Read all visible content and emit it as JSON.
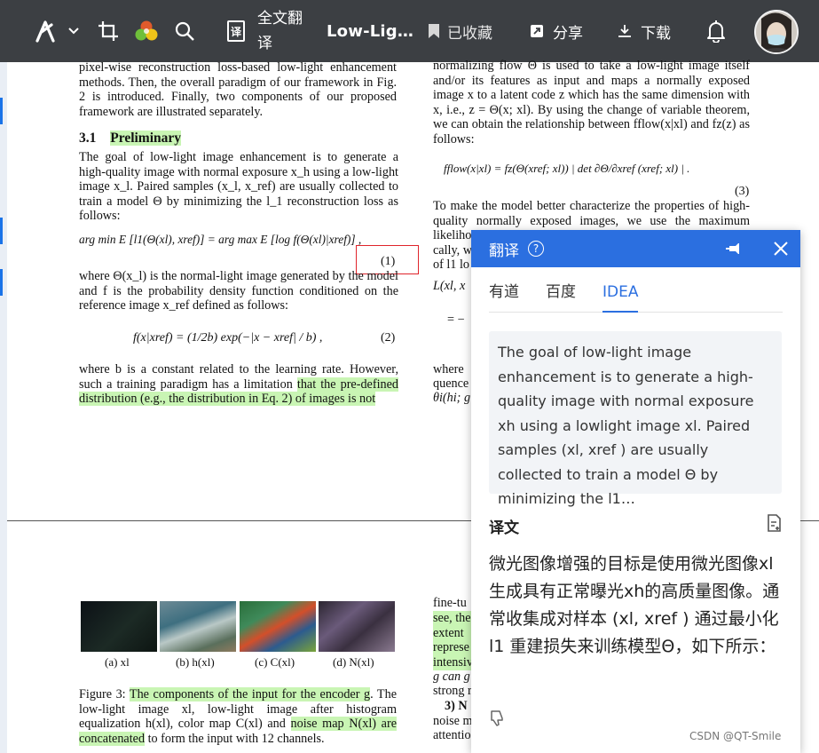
{
  "toolbar": {
    "full_translate": "全文翻译",
    "doc_title": "Low-Lig…",
    "favorited": "已收藏",
    "share": "分享",
    "download": "下载"
  },
  "paper": {
    "left_intro": "pixel-wise reconstruction loss-based low-light enhancement methods.  Then, the overall paradigm of our framework in Fig. 2 is introduced. Finally, two components of our proposed framework are illustrated separately.",
    "section_num": "3.1",
    "section_title": "Preliminary",
    "left_p1": "The goal of low-light image enhancement is to generate a high-quality image with normal exposure x_h using a low-light image x_l. Paired samples (x_l, x_ref) are usually collected to train a model Θ by minimizing the l_1 reconstruction loss as follows:",
    "eq1": "arg min E [l1(Θ(xl), xref)] = arg max E [log f(Θ(xl)|xref)] ,",
    "eq1_num": "(1)",
    "left_p2": "where Θ(x_l) is the normal-light image generated by the model and f is the probability density function conditioned on the reference image x_ref defined as follows:",
    "eq2": "f(x|xref) = (1/2b) exp(−|x − xref| / b) ,",
    "eq2_num": "(2)",
    "left_p3_a": "where b is a constant related to the learning rate. However, such a training paradigm has a limitation ",
    "left_p3_hl": "that the pre-defined distribution (e.g., the distribution in Eq. 2) of images is not",
    "right_p1": "normalizing flow Θ is used to take a low-light image itself and/or its features as input and maps a normally exposed image x to a latent code z which has the same dimension with x, i.e., z = Θ(x; xl). By using the change of variable theorem, we can obtain the relationship between fflow(x|xl) and fz(z) as follows:",
    "eq3": "fflow(x|xl) = fz(Θ(xref; xl)) | det ∂Θ/∂xref (xref; xl) | .",
    "eq3_num": "(3)",
    "right_p2": "To make the model better characterize the properties of high-quality normally exposed images, we use the maximum likelihood …",
    "right_frag1": "likeliho",
    "right_frag2": "cally, w",
    "right_frag3": "of l1 lo",
    "right_frag4": "L(xl, x",
    "right_frag5": "= −",
    "right_frag6": "where",
    "right_frag7": "quence",
    "right_frag8": "θi(hi; g",
    "fig_caps": [
      "(a) xl",
      "(b) h(xl)",
      "(c) C(xl)",
      "(d) N(xl)"
    ],
    "fig3_a": "Figure 3: ",
    "fig3_hl": "The components of the input for the encoder g",
    "fig3_b": ". The low-light image xl, low-light image after histogram equalization h(xl), color map C(xl) and ",
    "fig3_hl2": "noise map N(xl) are concatenated",
    "fig3_c": " to form the input with 12 channels.",
    "right_b1": "fine-tu",
    "right_b2": "see, the",
    "right_b3": "extent u",
    "right_b4": "represe",
    "right_b5": "intensiv",
    "right_b6": "g can g",
    "right_b7": "strong r",
    "right_b8": "3) N",
    "right_b9": "noise m",
    "right_b10": "attentio"
  },
  "panel": {
    "title": "翻译",
    "help": "?",
    "tabs": [
      "有道",
      "百度",
      "IDEA"
    ],
    "active_tab": "IDEA",
    "source_text": "The goal of low-light image enhancement is to generate a high-quality image with normal exposure xh using a lowlight image xl. Paired samples (xl, xref ) are usually collected to train a model Θ by minimizing the l1…",
    "yiwen_label": "译文",
    "target_text": "微光图像增强的目标是使用微光图像xl生成具有正常曝光xh的高质量图像。通常收集成对样本 (xl, xref ) 通过最小化 l1 重建损失来训练模型Θ，如下所示："
  },
  "watermark": "CSDN @QT-Smile",
  "colors": {
    "toolbar": "#3c3f43",
    "accent": "#2b6fe0",
    "highlight": "#c9f5b4"
  }
}
